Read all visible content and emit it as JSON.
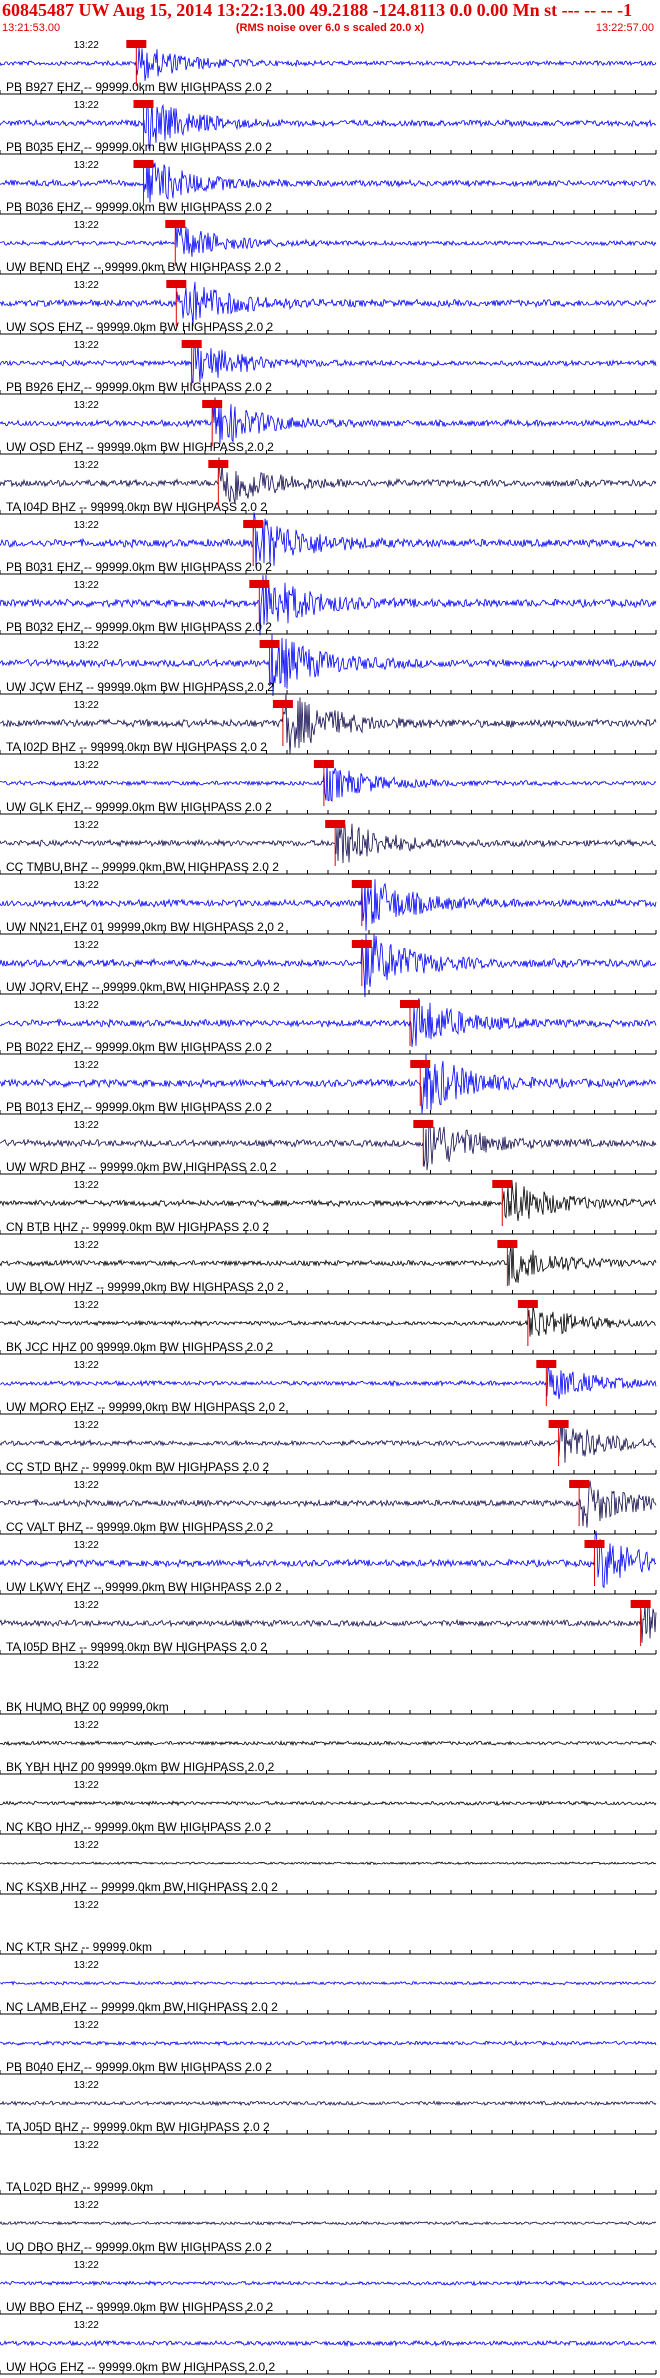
{
  "header": {
    "title": "60845487 UW Aug 15, 2014 13:22:13.00   49.2188 -124.8113  0.0 0.00 Mn st --- -- --  -1",
    "start_time": "13:21:53.00",
    "subtitle": "(RMS noise over 6.0 s scaled 20.0 x)",
    "end_time": "13:22:57.00"
  },
  "colors": {
    "blue": "#0000ff",
    "navy": "#150f4f",
    "black": "#000000",
    "pick": "#e00000"
  },
  "chart_data": {
    "type": "seismogram",
    "x_start": "13:21:53.00",
    "x_end": "13:22:57.00",
    "tick_label": "13:22",
    "traces": [
      {
        "label": "PB B927 EHZ -- 99999.0km BW  HIGHPASS  2.0  2",
        "color": "blue",
        "pick": 13.3,
        "amp": 0.6
      },
      {
        "label": "PB B035 EHZ -- 99999.0km BW  HIGHPASS  2.0  2",
        "color": "blue",
        "pick": 14.0,
        "amp": 0.8
      },
      {
        "label": "PB B036 EHZ -- 99999.0km BW  HIGHPASS  2.0  2",
        "color": "blue",
        "pick": 14.0,
        "amp": 0.8
      },
      {
        "label": "UW BEND EHZ -- 99999.0km BW  HIGHPASS  2.0  2",
        "color": "blue",
        "pick": 17.1,
        "amp": 0.6
      },
      {
        "label": "UW SOS EHZ -- 99999.0km BW  HIGHPASS  2.0  2",
        "color": "blue",
        "pick": 17.2,
        "amp": 0.9
      },
      {
        "label": "PB B926 EHZ -- 99999.0km BW  HIGHPASS  2.0  2",
        "color": "blue",
        "pick": 18.7,
        "amp": 0.7
      },
      {
        "label": "UW OSD EHZ -- 99999.0km BW  HIGHPASS  2.0  2",
        "color": "blue",
        "pick": 20.7,
        "amp": 0.8
      },
      {
        "label": "TA I04D BHZ -- 99999.0km BW  HIGHPASS  2.0  2",
        "color": "navy",
        "pick": 21.3,
        "amp": 0.9
      },
      {
        "label": "PB B031 EHZ -- 99999.0km BW  HIGHPASS  2.0  2",
        "color": "blue",
        "pick": 24.7,
        "amp": 1.0
      },
      {
        "label": "PB B032 EHZ -- 99999.0km BW  HIGHPASS  2.0  2",
        "color": "blue",
        "pick": 25.3,
        "amp": 1.0
      },
      {
        "label": "UW JCW EHZ -- 99999.0km BW  HIGHPASS  2.0  2",
        "color": "blue",
        "pick": 26.3,
        "amp": 1.0
      },
      {
        "label": "TA I02D BHZ -- 99999.0km BW  HIGHPASS  2.0  2",
        "color": "navy",
        "pick": 27.6,
        "amp": 1.0
      },
      {
        "label": "UW GLK EHZ -- 99999.0km BW  HIGHPASS  2.0  2",
        "color": "blue",
        "pick": 31.6,
        "amp": 0.6
      },
      {
        "label": "CC TMBU BHZ -- 99999.0km BW  HIGHPASS  2.0  2",
        "color": "navy",
        "pick": 32.7,
        "amp": 0.8
      },
      {
        "label": "UW NN21 EHZ 01 99999.0km BW  HIGHPASS  2.0  2",
        "color": "blue",
        "pick": 35.3,
        "amp": 0.9
      },
      {
        "label": "UW JORV EHZ -- 99999.0km BW  HIGHPASS  2.0  2",
        "color": "blue",
        "pick": 35.3,
        "amp": 1.0
      },
      {
        "label": "PB B022 EHZ -- 99999.0km BW  HIGHPASS  2.0  2",
        "color": "blue",
        "pick": 40.0,
        "amp": 0.9
      },
      {
        "label": "PB B013 EHZ -- 99999.0km BW  HIGHPASS  2.0  2",
        "color": "blue",
        "pick": 41.0,
        "amp": 1.0
      },
      {
        "label": "UW WRD BHZ -- 99999.0km BW  HIGHPASS  2.0  2",
        "color": "navy",
        "pick": 41.3,
        "amp": 0.9
      },
      {
        "label": "CN BTB HHZ -- 99999.0km BW  HIGHPASS  2.0  2",
        "color": "black",
        "pick": 49.0,
        "amp": 0.8
      },
      {
        "label": "UW BLOW HHZ -- 99999.0km BW  HIGHPASS  2.0  2",
        "color": "black",
        "pick": 49.5,
        "amp": 0.7
      },
      {
        "label": "BK JCC HHZ 00 99999.0km BW  HIGHPASS  2.0  2",
        "color": "black",
        "pick": 51.5,
        "amp": 0.6
      },
      {
        "label": "UW MORO EHZ -- 99999.0km BW  HIGHPASS  2.0  2",
        "color": "blue",
        "pick": 53.3,
        "amp": 0.6
      },
      {
        "label": "CC STD BHZ -- 99999.0km BW  HIGHPASS  2.0  2",
        "color": "navy",
        "pick": 54.5,
        "amp": 0.7
      },
      {
        "label": "CC VALT BHZ -- 99999.0km BW  HIGHPASS  2.0  2",
        "color": "navy",
        "pick": 56.5,
        "amp": 0.8
      },
      {
        "label": "UW LKWY EHZ -- 99999.0km BW  HIGHPASS  2.0  2",
        "color": "blue",
        "pick": 58.0,
        "amp": 0.9
      },
      {
        "label": "TA I05D BHZ -- 99999.0km BW  HIGHPASS  2.0  2",
        "color": "navy",
        "pick": 62.5,
        "amp": 0.8
      },
      {
        "label": "BK HUMO BHZ 00 99999.0km",
        "color": "black",
        "amp": 0.0
      },
      {
        "label": "BK YBH HHZ 00 99999.0km BW  HIGHPASS  2.0  2",
        "color": "black",
        "amp": 0.5
      },
      {
        "label": "NC KBO HHZ -- 99999.0km BW  HIGHPASS  2.0  2",
        "color": "black",
        "amp": 0.5
      },
      {
        "label": "NC KSXB HHZ -- 99999.0km BW  HIGHPASS  2.0  2",
        "color": "black",
        "amp": 0.3
      },
      {
        "label": "NC KTR SHZ -- 99999.0km",
        "color": "blue",
        "amp": 0.0
      },
      {
        "label": "NC LAMB EHZ -- 99999.0km BW  HIGHPASS  2.0  2",
        "color": "blue",
        "amp": 0.4
      },
      {
        "label": "PB B040 EHZ -- 99999.0km BW  HIGHPASS  2.0  2",
        "color": "blue",
        "amp": 0.5
      },
      {
        "label": "TA J05D BHZ -- 99999.0km BW  HIGHPASS  2.0  2",
        "color": "navy",
        "amp": 0.5
      },
      {
        "label": "TA L02D BHZ -- 99999.0km",
        "color": "black",
        "amp": 0.0
      },
      {
        "label": "UO DBO BHZ -- 99999.0km BW  HIGHPASS  2.0  2",
        "color": "navy",
        "amp": 0.4
      },
      {
        "label": "UW BBO EHZ -- 99999.0km BW  HIGHPASS  2.0  2",
        "color": "blue",
        "amp": 0.5
      },
      {
        "label": "UW HOG EHZ -- 99999.0km BW  HIGHPASS  2.0  2",
        "color": "blue",
        "amp": 0.6
      }
    ]
  }
}
